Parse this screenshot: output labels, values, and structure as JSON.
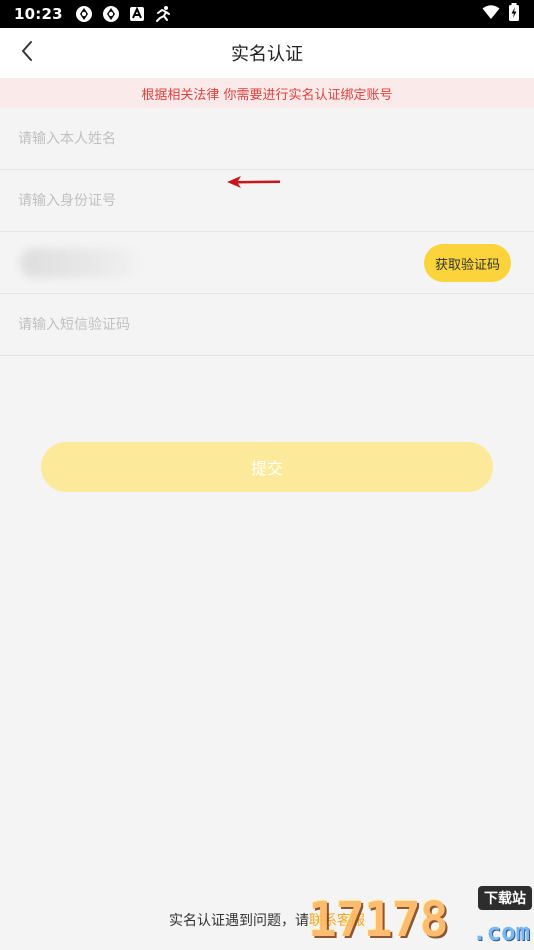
{
  "status_bar": {
    "time": "10:23",
    "icons": [
      "sync-icon",
      "sync-icon",
      "a-badge-icon",
      "runner-icon"
    ],
    "right_icons": [
      "wifi-icon",
      "battery-charging-icon"
    ]
  },
  "nav": {
    "back_icon": "chevron-left-icon",
    "title": "实名认证"
  },
  "notice": {
    "text": "根据相关法律 你需要进行实名认证绑定账号",
    "color": "#e0413c",
    "background": "#fbeaea"
  },
  "form": {
    "name_placeholder": "请输入本人姓名",
    "id_placeholder": "请输入身份证号",
    "get_code_label": "获取验证码",
    "sms_placeholder": "请输入短信验证码"
  },
  "submit": {
    "label": "提交",
    "color": "#fde99a"
  },
  "footer": {
    "text": "实名认证遇到问题，请",
    "link_text": "联系客服",
    "link_color": "#f5a623"
  },
  "watermark": {
    "number": "17178",
    "tag": "下载站",
    "domain": ".com"
  },
  "accent_color": "#fbd43b"
}
